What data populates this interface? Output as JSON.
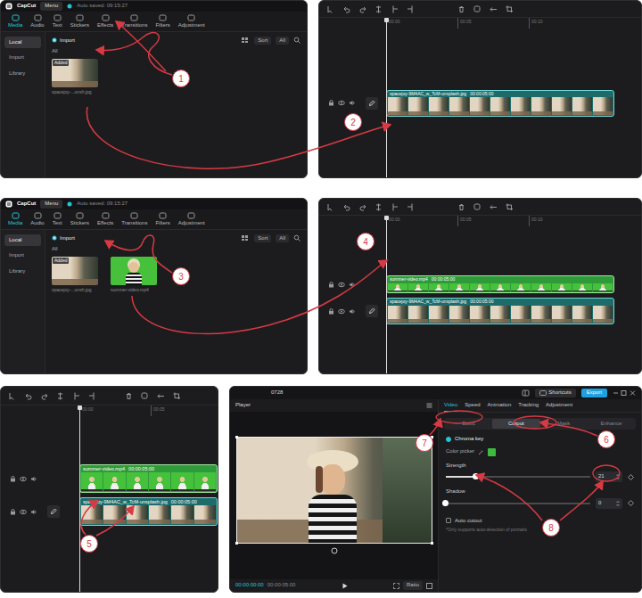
{
  "panels": {
    "media1": {
      "app": {
        "logo": "CapCut",
        "menu": "Menu",
        "autosave": "Auto saved: 09:15:27"
      },
      "tabs": [
        {
          "label": "Media",
          "selected": true
        },
        {
          "label": "Audio",
          "selected": false
        },
        {
          "label": "Text",
          "selected": false
        },
        {
          "label": "Stickers",
          "selected": false
        },
        {
          "label": "Effects",
          "selected": false
        },
        {
          "label": "Transitions",
          "selected": false
        },
        {
          "label": "Filters",
          "selected": false
        },
        {
          "label": "Adjustment",
          "selected": false
        }
      ],
      "sidebar": [
        {
          "label": "Local",
          "selected": true
        },
        {
          "label": "Import",
          "selected": false
        },
        {
          "label": "Library",
          "selected": false
        }
      ],
      "import": "Import",
      "sort": "Sort",
      "filter": "All",
      "section": "All",
      "items": [
        {
          "badge": "Added",
          "name": "spacejoy-...unsh.jpg",
          "kind": "photo"
        }
      ]
    },
    "timeline1": {
      "ruler": [
        "00:00",
        "00:05",
        "00:10"
      ],
      "tracks": [
        {
          "name": "spacejoy-9M4AC_w_TcM-unsplash.jpg",
          "duration": "00:00:05:00",
          "kind": "photo",
          "main": true
        }
      ]
    },
    "media2": {
      "app": {
        "logo": "CapCut",
        "menu": "Menu",
        "autosave": "Auto saved: 09:15:27"
      },
      "tabs": [
        {
          "label": "Media",
          "selected": true
        },
        {
          "label": "Audio",
          "selected": false
        },
        {
          "label": "Text",
          "selected": false
        },
        {
          "label": "Stickers",
          "selected": false
        },
        {
          "label": "Effects",
          "selected": false
        },
        {
          "label": "Transitions",
          "selected": false
        },
        {
          "label": "Filters",
          "selected": false
        },
        {
          "label": "Adjustment",
          "selected": false
        }
      ],
      "sidebar": [
        {
          "label": "Local",
          "selected": true
        },
        {
          "label": "Import",
          "selected": false
        },
        {
          "label": "Library",
          "selected": false
        }
      ],
      "import": "Import",
      "sort": "Sort",
      "filter": "All",
      "section": "All",
      "items": [
        {
          "badge": "Added",
          "name": "spacejoy-...unsh.jpg",
          "kind": "photo"
        },
        {
          "badge": "",
          "name": "summer-video.mp4",
          "kind": "video"
        }
      ]
    },
    "timeline2": {
      "ruler": [
        "00:00",
        "00:05",
        "00:10"
      ],
      "tracks": [
        {
          "name": "summer-video.mp4",
          "duration": "00:00:05:00",
          "kind": "video",
          "main": false
        },
        {
          "name": "spacejoy-9M4AC_w_TcM-unsplash.jpg",
          "duration": "00:00:05:00",
          "kind": "photo",
          "main": true
        }
      ]
    },
    "timeline3": {
      "ruler": [
        "00:00",
        "00:05"
      ],
      "tracks": [
        {
          "name": "summer-video.mp4",
          "duration": "00:00:05:00",
          "kind": "video",
          "main": false
        },
        {
          "name": "spacejoy-9M4AC_w_TcM-unsplash.jpg",
          "duration": "00:00:05:00",
          "kind": "photo",
          "main": true
        }
      ]
    },
    "editor": {
      "title": "0728",
      "shortcuts": "Shortcuts",
      "export": "Export",
      "player": {
        "label": "Player",
        "time": "00:00:00:00",
        "duration": "00:00:05:00",
        "ratio": "Ratio"
      },
      "tabs": [
        {
          "label": "Video",
          "selected": true
        },
        {
          "label": "Speed",
          "selected": false
        },
        {
          "label": "Animation",
          "selected": false
        },
        {
          "label": "Tracking",
          "selected": false
        },
        {
          "label": "Adjustment",
          "selected": false
        }
      ],
      "subtabs": [
        {
          "label": "Basic",
          "selected": false
        },
        {
          "label": "Cutout",
          "selected": true
        },
        {
          "label": "Mask",
          "selected": false
        },
        {
          "label": "Enhance",
          "selected": false
        }
      ],
      "chroma_key": {
        "label": "Chroma key",
        "checked": true
      },
      "color_picker": {
        "label": "Color picker",
        "color": "#3dbb3d"
      },
      "sliders": [
        {
          "label": "Strength",
          "level": 0.21,
          "reading": "21"
        },
        {
          "label": "Shadow",
          "level": 0,
          "reading": "0"
        }
      ],
      "auto_cutout": {
        "label": "Auto cutout",
        "checked": false,
        "note": "*Only supports auto-detection of portraits"
      }
    }
  },
  "annotations": [
    {
      "number": "1"
    },
    {
      "number": "2"
    },
    {
      "number": "3"
    },
    {
      "number": "4"
    },
    {
      "number": "5"
    },
    {
      "number": "6"
    },
    {
      "number": "7"
    },
    {
      "number": "8"
    }
  ]
}
